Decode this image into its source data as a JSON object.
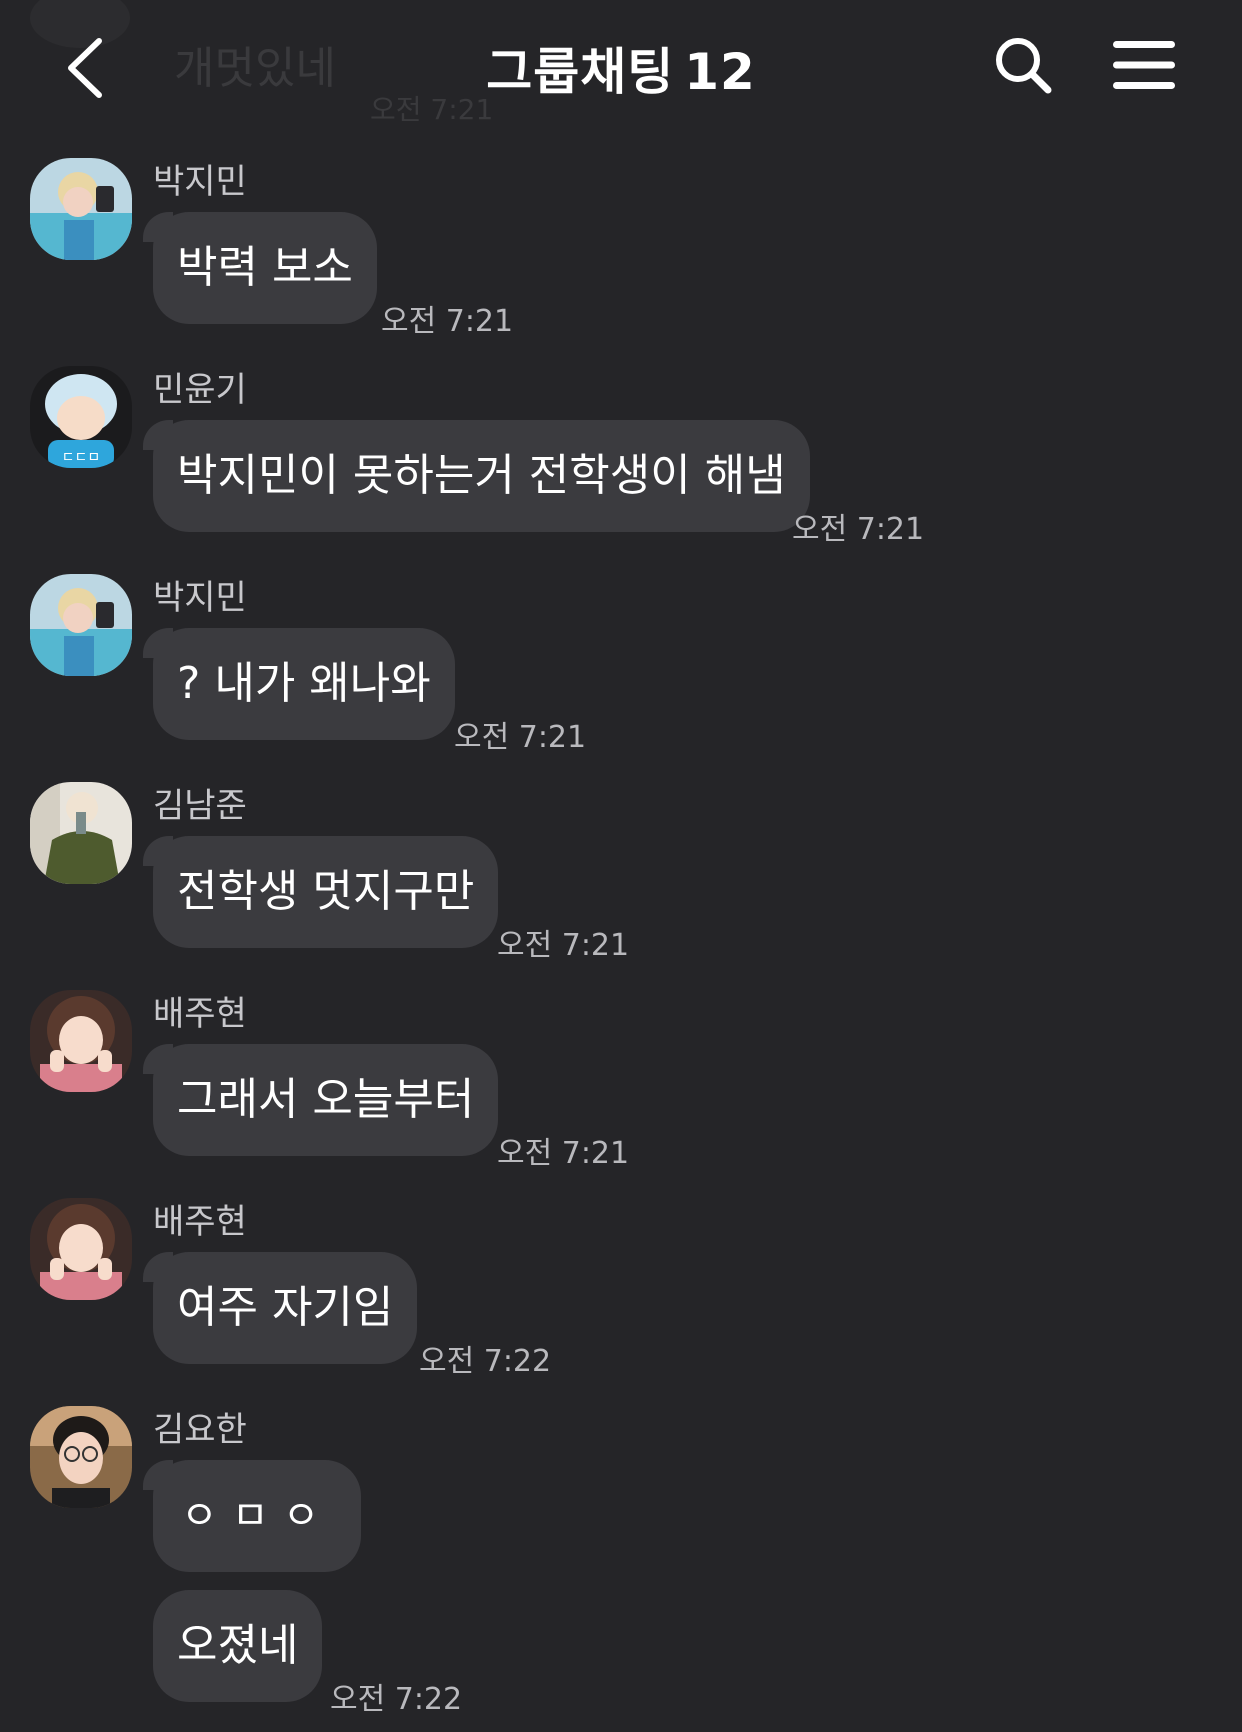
{
  "header": {
    "title": "그룹채팅",
    "member_count": "12",
    "back_icon": "chevron-left-icon",
    "search_icon": "search-icon",
    "menu_icon": "hamburger-menu-icon"
  },
  "partial_previous": {
    "message": "개멋있네",
    "time": "오전 7:21"
  },
  "messages": [
    {
      "sender": "박지민",
      "bubbles": [
        "박력 보소"
      ],
      "time": "오전 7:21"
    },
    {
      "sender": "민윤기",
      "bubbles": [
        "박지민이 못하는거 전학생이 해냄"
      ],
      "time": "오전 7:21"
    },
    {
      "sender": "박지민",
      "bubbles": [
        "? 내가 왜나와"
      ],
      "time": "오전 7:21"
    },
    {
      "sender": "김남준",
      "bubbles": [
        "전학생 멋지구만"
      ],
      "time": "오전 7:21"
    },
    {
      "sender": "배주현",
      "bubbles": [
        "그래서 오늘부터"
      ],
      "time": "오전 7:21"
    },
    {
      "sender": "배주현",
      "bubbles": [
        "여주 자기임"
      ],
      "time": "오전 7:22"
    },
    {
      "sender": "김요한",
      "bubbles": [
        "ㅇㅁㅇ",
        "오졌네"
      ],
      "time": "오전 7:22"
    }
  ],
  "theme": {
    "background": "#252528",
    "bubble": "#3b3b3f",
    "text": "#ffffff",
    "secondary_text": "#b9b9bd"
  }
}
